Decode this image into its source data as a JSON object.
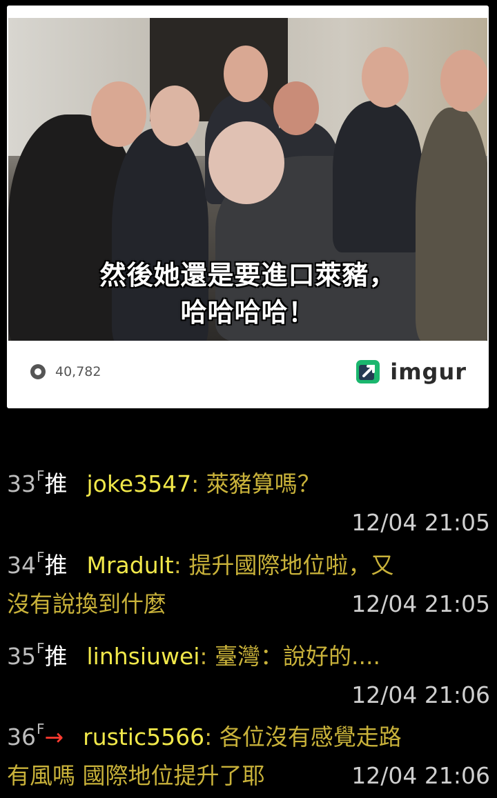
{
  "embed": {
    "caption_line1": "然後她還是要進口萊豬，",
    "caption_line2": "哈哈哈哈！",
    "view_count": "40,782",
    "brand": "imgur",
    "brand_color": "#1bb76e"
  },
  "comments": [
    {
      "floor": "33",
      "floor_suffix": "F",
      "tag": "推",
      "user": "joke3547",
      "text_line1": "萊豬算嗎？",
      "text_line2": "",
      "time": "12/04 21:05"
    },
    {
      "floor": "34",
      "floor_suffix": "F",
      "tag": "推",
      "user": "Mradult",
      "text_line1": "提升國際地位啦，又",
      "text_line2": "沒有說換到什麼",
      "time": "12/04 21:05"
    },
    {
      "floor": "35",
      "floor_suffix": "F",
      "tag": "推",
      "user": "linhsiuwei",
      "text_line1": "臺灣：說好的....",
      "text_line2": "",
      "time": "12/04 21:06"
    },
    {
      "floor": "36",
      "floor_suffix": "F",
      "tag": "→",
      "user": "rustic5566",
      "text_line1": "各位沒有感覺走路",
      "text_line2": "有風嗎 國際地位提升了耶",
      "time": "12/04 21:06"
    }
  ]
}
